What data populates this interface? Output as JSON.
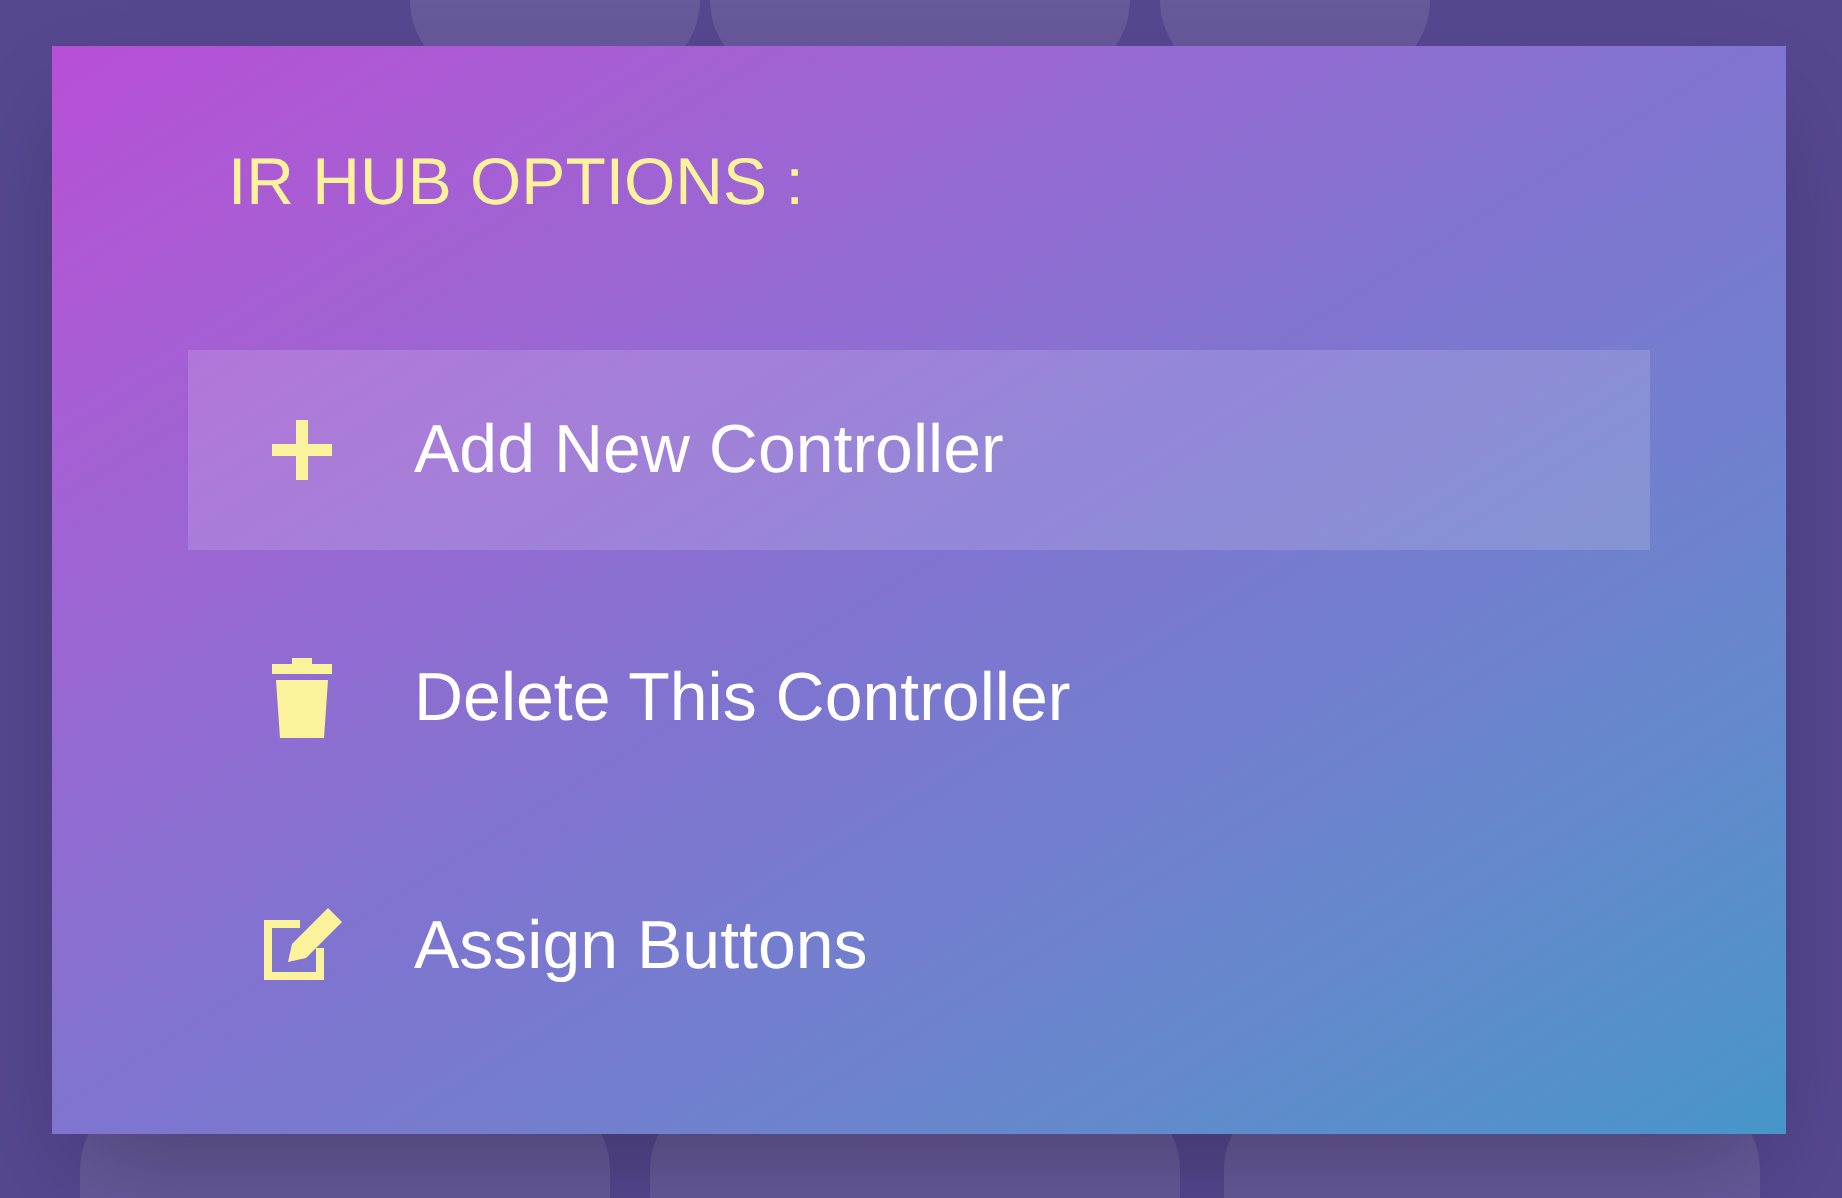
{
  "dialog": {
    "title": "IR HUB OPTIONS :",
    "items": [
      {
        "kind": "add",
        "label": "Add New Controller",
        "selected": true
      },
      {
        "kind": "delete",
        "label": "Delete This Controller",
        "selected": false
      },
      {
        "kind": "edit",
        "label": "Assign Buttons",
        "selected": false
      }
    ]
  }
}
